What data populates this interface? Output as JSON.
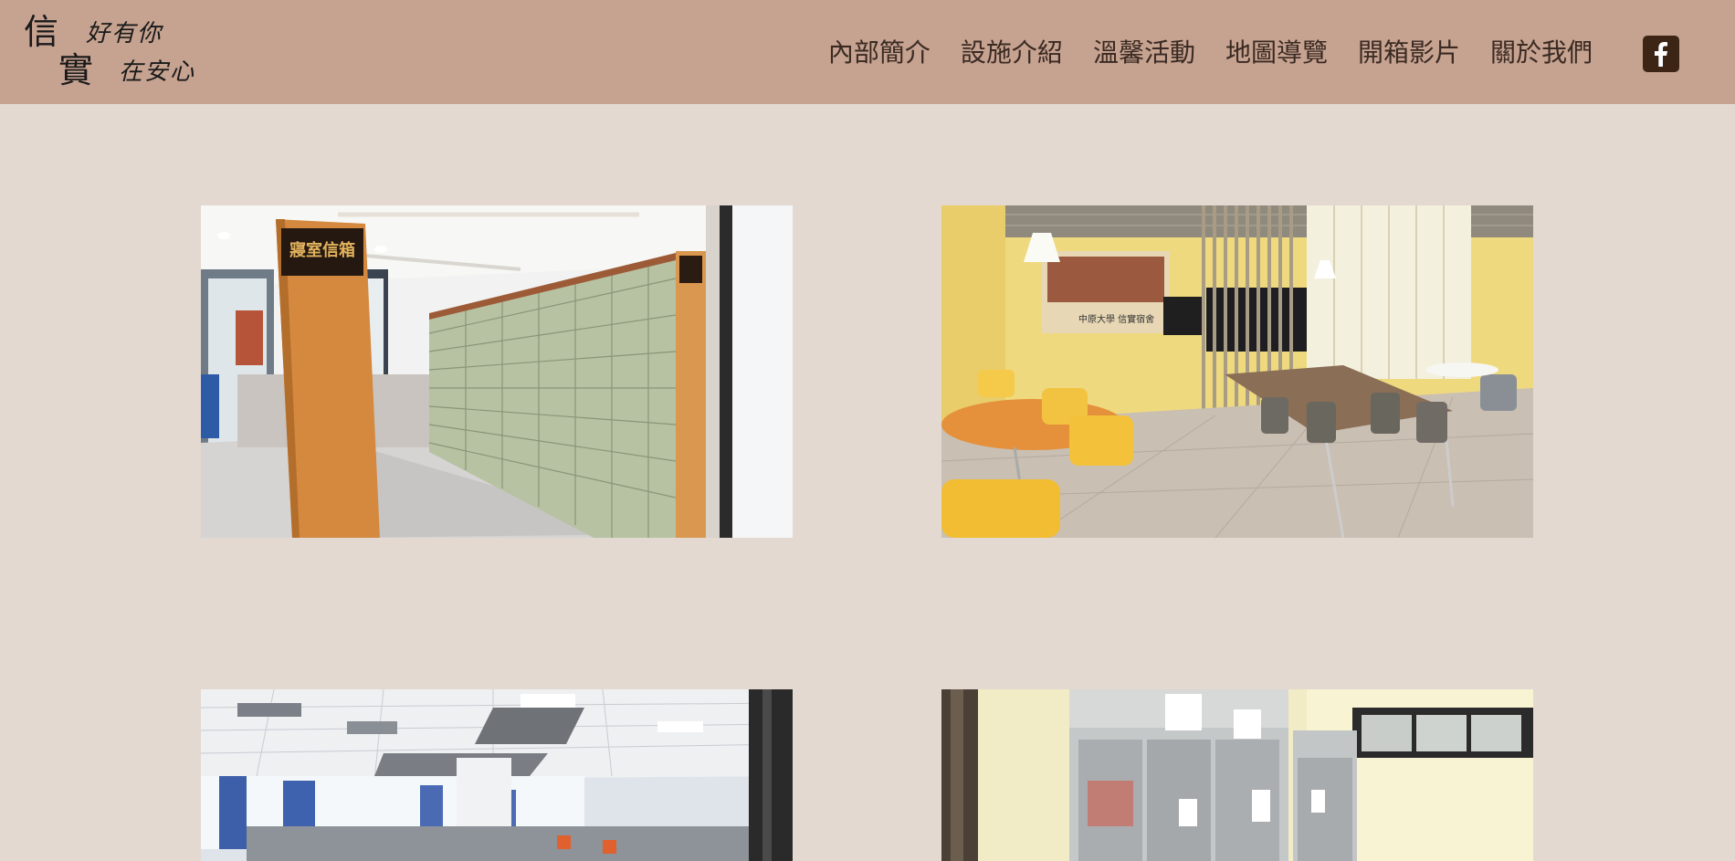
{
  "logo": {
    "char_top": "信",
    "char_bottom": "實",
    "line_top": "好有你",
    "line_bottom": "在安心"
  },
  "nav": {
    "items": [
      {
        "label": "內部簡介"
      },
      {
        "label": "設施介紹"
      },
      {
        "label": "溫馨活動"
      },
      {
        "label": "地圖導覽"
      },
      {
        "label": "開箱影片"
      },
      {
        "label": "關於我們"
      }
    ]
  },
  "social": {
    "icon": "facebook-icon"
  },
  "photos": {
    "mailbox_sign": "寢室信箱",
    "lounge_board": "中原大學 信實宿舍"
  },
  "colors": {
    "background": "#e4d9d1",
    "header": "#c6a290",
    "nav_text": "#3a2a22",
    "facebook_bg": "#3d2515"
  }
}
